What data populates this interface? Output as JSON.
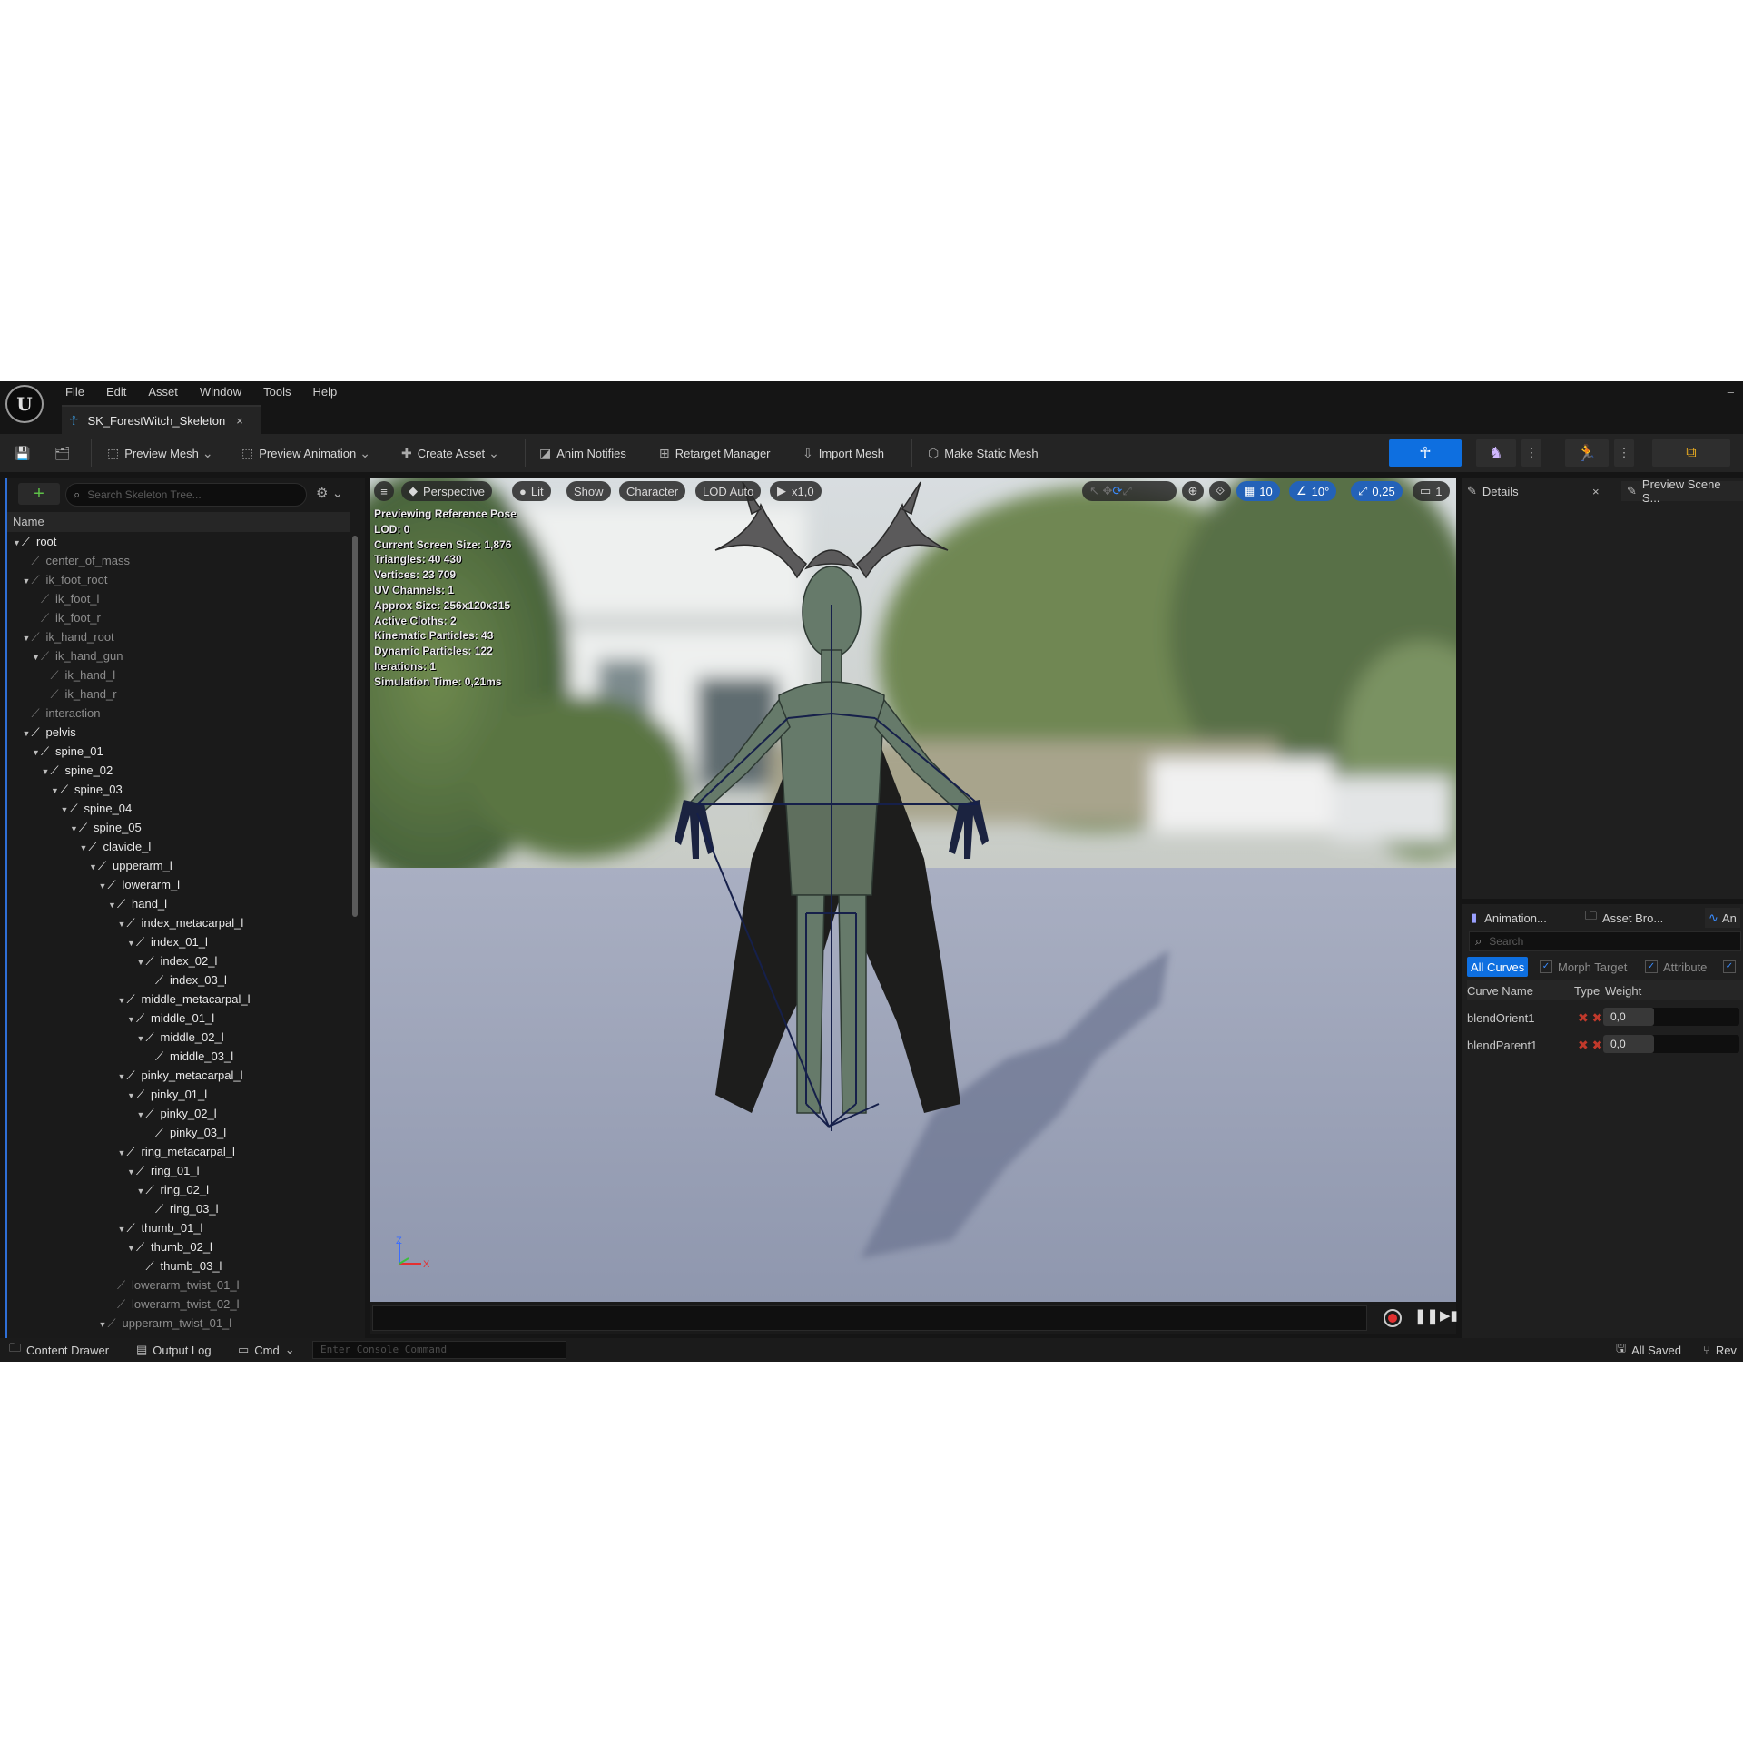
{
  "menu": [
    "File",
    "Edit",
    "Asset",
    "Window",
    "Tools",
    "Help"
  ],
  "asset_tab": {
    "label": "SK_ForestWitch_Skeleton",
    "close": "×"
  },
  "window_min": "–",
  "toolbar": {
    "preview_mesh": "Preview Mesh",
    "preview_animation": "Preview Animation",
    "create_asset": "Create Asset",
    "anim_notifies": "Anim Notifies",
    "retarget_manager": "Retarget Manager",
    "import_mesh": "Import Mesh",
    "make_static_mesh": "Make Static Mesh",
    "accent_color": "#0e6fe0"
  },
  "skeleton_tree": {
    "search_placeholder": "Search Skeleton Tree...",
    "name_header": "Name",
    "bones": [
      {
        "name": "root",
        "depth": 0,
        "active": true,
        "expanded": true
      },
      {
        "name": "center_of_mass",
        "depth": 1,
        "active": false,
        "expanded": false
      },
      {
        "name": "ik_foot_root",
        "depth": 1,
        "active": false,
        "expanded": true
      },
      {
        "name": "ik_foot_l",
        "depth": 2,
        "active": false,
        "expanded": false
      },
      {
        "name": "ik_foot_r",
        "depth": 2,
        "active": false,
        "expanded": false
      },
      {
        "name": "ik_hand_root",
        "depth": 1,
        "active": false,
        "expanded": true
      },
      {
        "name": "ik_hand_gun",
        "depth": 2,
        "active": false,
        "expanded": true
      },
      {
        "name": "ik_hand_l",
        "depth": 3,
        "active": false,
        "expanded": false
      },
      {
        "name": "ik_hand_r",
        "depth": 3,
        "active": false,
        "expanded": false
      },
      {
        "name": "interaction",
        "depth": 1,
        "active": false,
        "expanded": false
      },
      {
        "name": "pelvis",
        "depth": 1,
        "active": true,
        "expanded": true
      },
      {
        "name": "spine_01",
        "depth": 2,
        "active": true,
        "expanded": true
      },
      {
        "name": "spine_02",
        "depth": 3,
        "active": true,
        "expanded": true
      },
      {
        "name": "spine_03",
        "depth": 4,
        "active": true,
        "expanded": true
      },
      {
        "name": "spine_04",
        "depth": 5,
        "active": true,
        "expanded": true
      },
      {
        "name": "spine_05",
        "depth": 6,
        "active": true,
        "expanded": true
      },
      {
        "name": "clavicle_l",
        "depth": 7,
        "active": true,
        "expanded": true
      },
      {
        "name": "upperarm_l",
        "depth": 8,
        "active": true,
        "expanded": true
      },
      {
        "name": "lowerarm_l",
        "depth": 9,
        "active": true,
        "expanded": true
      },
      {
        "name": "hand_l",
        "depth": 10,
        "active": true,
        "expanded": true
      },
      {
        "name": "index_metacarpal_l",
        "depth": 11,
        "active": true,
        "expanded": true
      },
      {
        "name": "index_01_l",
        "depth": 12,
        "active": true,
        "expanded": true
      },
      {
        "name": "index_02_l",
        "depth": 13,
        "active": true,
        "expanded": true
      },
      {
        "name": "index_03_l",
        "depth": 14,
        "active": true,
        "expanded": false
      },
      {
        "name": "middle_metacarpal_l",
        "depth": 11,
        "active": true,
        "expanded": true
      },
      {
        "name": "middle_01_l",
        "depth": 12,
        "active": true,
        "expanded": true
      },
      {
        "name": "middle_02_l",
        "depth": 13,
        "active": true,
        "expanded": true
      },
      {
        "name": "middle_03_l",
        "depth": 14,
        "active": true,
        "expanded": false
      },
      {
        "name": "pinky_metacarpal_l",
        "depth": 11,
        "active": true,
        "expanded": true
      },
      {
        "name": "pinky_01_l",
        "depth": 12,
        "active": true,
        "expanded": true
      },
      {
        "name": "pinky_02_l",
        "depth": 13,
        "active": true,
        "expanded": true
      },
      {
        "name": "pinky_03_l",
        "depth": 14,
        "active": true,
        "expanded": false
      },
      {
        "name": "ring_metacarpal_l",
        "depth": 11,
        "active": true,
        "expanded": true
      },
      {
        "name": "ring_01_l",
        "depth": 12,
        "active": true,
        "expanded": true
      },
      {
        "name": "ring_02_l",
        "depth": 13,
        "active": true,
        "expanded": true
      },
      {
        "name": "ring_03_l",
        "depth": 14,
        "active": true,
        "expanded": false
      },
      {
        "name": "thumb_01_l",
        "depth": 11,
        "active": true,
        "expanded": true
      },
      {
        "name": "thumb_02_l",
        "depth": 12,
        "active": true,
        "expanded": true
      },
      {
        "name": "thumb_03_l",
        "depth": 13,
        "active": true,
        "expanded": false
      },
      {
        "name": "lowerarm_twist_01_l",
        "depth": 10,
        "active": false,
        "expanded": false
      },
      {
        "name": "lowerarm_twist_02_l",
        "depth": 10,
        "active": false,
        "expanded": false
      },
      {
        "name": "upperarm_twist_01_l",
        "depth": 9,
        "active": false,
        "expanded": true
      }
    ]
  },
  "viewport": {
    "menu_icon": "≡",
    "perspective": "Perspective",
    "lit": "Lit",
    "show": "Show",
    "character": "Character",
    "lod": "LOD Auto",
    "play_speed": "x1,0",
    "grid_snap": "10",
    "rotation_snap": "10°",
    "scale_snap": "0,25",
    "camera_speed": "1",
    "stats": [
      "Previewing Reference Pose",
      "LOD: 0",
      "Current Screen Size: 1,876",
      "Triangles: 40 430",
      "Vertices: 23 709",
      "UV Channels: 1",
      "Approx Size: 256x120x315",
      "Active Cloths: 2",
      "Kinematic Particles: 43",
      "Dynamic Particles: 122",
      "Iterations: 1",
      "Simulation Time: 0,21ms"
    ],
    "axis_z": "Z",
    "axis_x": "X"
  },
  "details": {
    "tab_details": "Details",
    "tab_preview_scene": "Preview Scene S..."
  },
  "curves": {
    "tab_animation": "Animation...",
    "tab_asset_browser": "Asset Bro...",
    "tab_anim": "An",
    "search_placeholder": "Search",
    "filter_all": "All Curves",
    "filter_morph": "Morph Target",
    "filter_attribute": "Attribute",
    "col_name": "Curve Name",
    "col_type": "Type",
    "col_weight": "Weight",
    "rows": [
      {
        "name": "blendOrient1",
        "weight": "0,0"
      },
      {
        "name": "blendParent1",
        "weight": "0,0"
      }
    ]
  },
  "statusbar": {
    "content_drawer": "Content Drawer",
    "output_log": "Output Log",
    "cmd": "Cmd",
    "console_placeholder": "Enter Console Command",
    "all_saved": "All Saved",
    "revision": "Rev"
  }
}
